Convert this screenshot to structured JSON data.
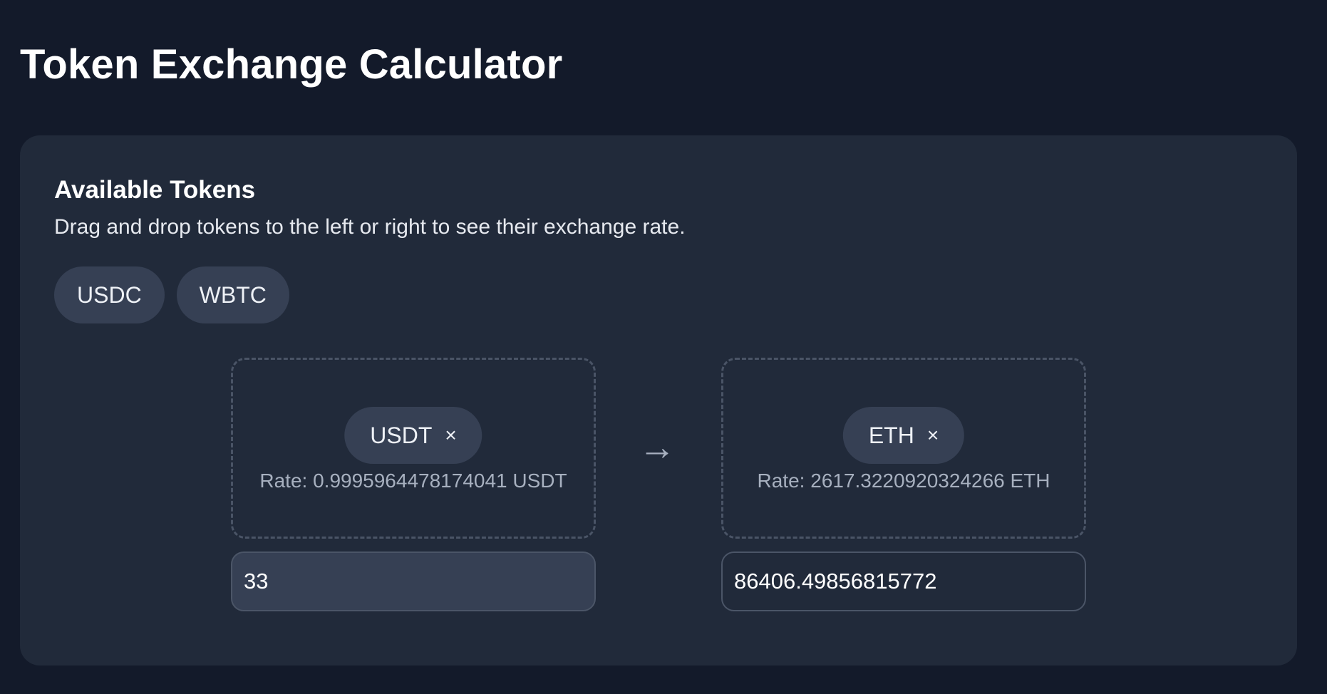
{
  "page": {
    "title": "Token Exchange Calculator"
  },
  "available": {
    "title": "Available Tokens",
    "description": "Drag and drop tokens to the left or right to see their exchange rate.",
    "tokens": [
      "USDC",
      "WBTC"
    ]
  },
  "exchange": {
    "arrow_glyph": "→",
    "remove_glyph": "×",
    "left": {
      "token": "USDT",
      "rate": "Rate: 0.9995964478174041 USDT",
      "amount": "33"
    },
    "right": {
      "token": "ETH",
      "rate": "Rate: 2617.3220920324266 ETH",
      "amount": "86406.49856815772"
    }
  },
  "colors": {
    "background": "#131a2a",
    "card": "#212a3a",
    "chip": "#364054",
    "muted_text": "#a7b0bf",
    "dashed_border": "#4a5466"
  },
  "icons": {
    "remove": "close-icon",
    "direction": "arrow-right-icon"
  }
}
